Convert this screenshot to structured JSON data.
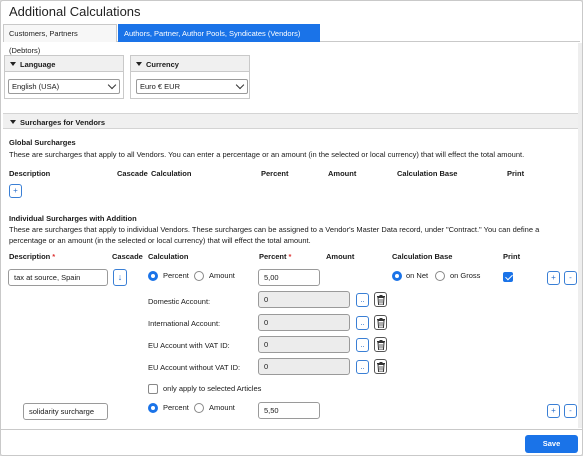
{
  "title": "Additional Calculations",
  "tabs": [
    {
      "label": "Customers, Partners (Debtors)",
      "active": false
    },
    {
      "label": "Authors, Partner, Author Pools, Syndicates (Vendors)",
      "active": true
    }
  ],
  "language": {
    "heading": "Language",
    "value": "English (USA)"
  },
  "currency": {
    "heading": "Currency",
    "value": "Euro € EUR"
  },
  "surcharges_section": "Surcharges for Vendors",
  "global": {
    "heading": "Global Surcharges",
    "description": "These are surcharges that apply to all Vendors. You can enter a percentage or an amount (in the selected or local currency) that will effect the total amount.",
    "columns": {
      "description": "Description",
      "cascade": "Cascade",
      "calculation": "Calculation",
      "percent": "Percent",
      "amount": "Amount",
      "calc_base": "Calculation Base",
      "print": "Print"
    },
    "add_label": "+"
  },
  "individual": {
    "heading": "Individual Surcharges with Addition",
    "description_line1": "These are surcharges that apply to individual Vendors. These surcharges can be assigned to a Vendor's Master Data record, under \"Contract.\" You can define a",
    "description_line2": "percentage or an amount (in the selected or local currency) that will effect the total amount.",
    "columns": {
      "description": "Description",
      "cascade": "Cascade",
      "calculation": "Calculation",
      "percent": "Percent",
      "amount": "Amount",
      "calc_base": "Calculation Base",
      "print": "Print"
    },
    "required_mark": "*",
    "rows": [
      {
        "description": "tax at source, Spain",
        "cascade_icon": "↓",
        "calc_percent": "Percent",
        "calc_amount": "Amount",
        "percent_value": "5,00",
        "base_net": "on Net",
        "base_gross": "on Gross",
        "print": true,
        "accounts": [
          {
            "label": "Domestic Account:",
            "value": "0"
          },
          {
            "label": "International Account:",
            "value": "0"
          },
          {
            "label": "EU Account with VAT ID:",
            "value": "0"
          },
          {
            "label": "EU Account without VAT ID:",
            "value": "0"
          }
        ],
        "only_selected_label": "only apply to selected Articles"
      },
      {
        "description": "solidarity surcharge",
        "calc_percent": "Percent",
        "calc_amount": "Amount",
        "percent_value": "5,50"
      }
    ],
    "lookup_label": "..",
    "plus_label": "+",
    "minus_label": "-"
  },
  "save_label": "Save",
  "colors": {
    "accent": "#1a73e8"
  }
}
